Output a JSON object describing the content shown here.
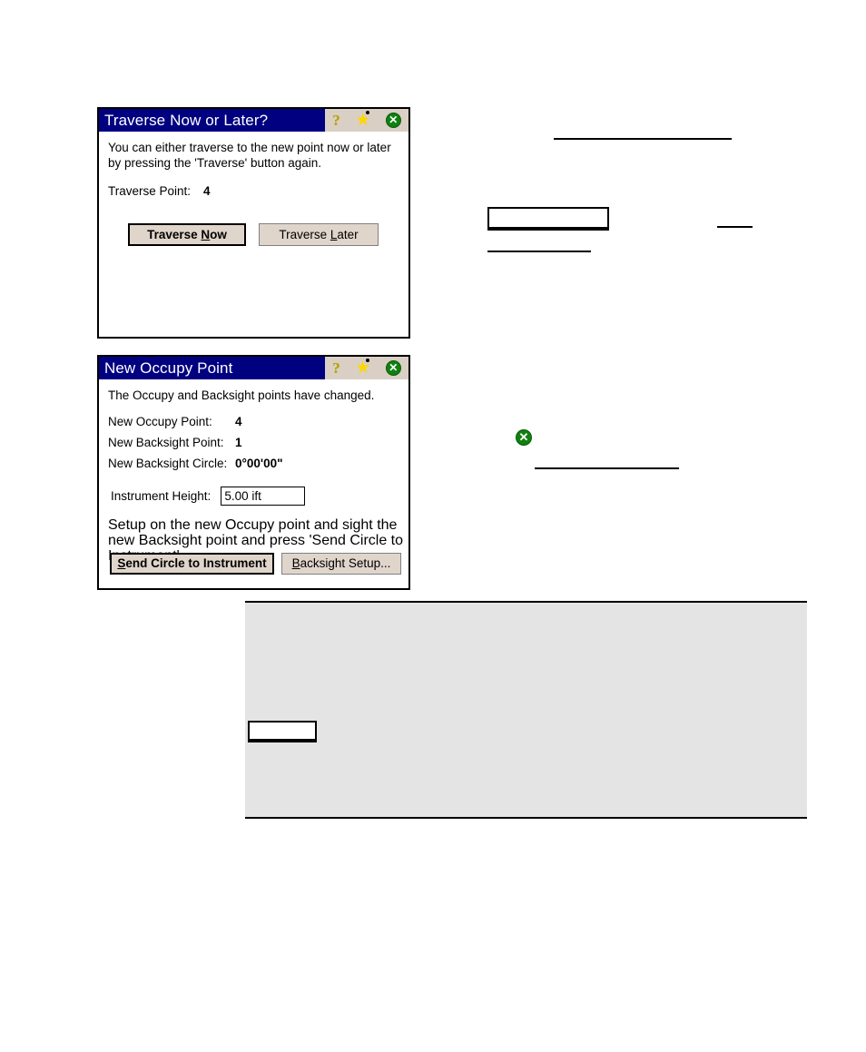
{
  "page": {
    "background_color": "#ffffff",
    "title_bar_color": "#000080",
    "button_face_color": "#e0d5cb",
    "panel_gray_color": "#e4e4e4",
    "close_icon_green": "#108010"
  },
  "dialog_traverse": {
    "title": "Traverse Now or Later?",
    "icons": {
      "help": "?",
      "star": "★",
      "close": "✕"
    },
    "message": "You can either traverse to the new point now or later by pressing the 'Traverse' button again.",
    "point_label": "Traverse Point:",
    "point_value": "4",
    "buttons": {
      "now_prefix": "Traverse ",
      "now_accel": "N",
      "now_suffix": "ow",
      "later_prefix": "Traverse ",
      "later_accel": "L",
      "later_suffix": "ater",
      "now_full": "Traverse Now",
      "later_full": "Traverse Later"
    }
  },
  "dialog_occupy": {
    "title": "New Occupy Point",
    "icons": {
      "help": "?",
      "star": "★",
      "close": "✕"
    },
    "message": "The Occupy and Backsight points have changed.",
    "fields": [
      {
        "label": "New Occupy Point:",
        "value": "4"
      },
      {
        "label": "New Backsight Point:",
        "value": "1"
      },
      {
        "label": "New Backsight Circle:",
        "value": "0°00'00\""
      }
    ],
    "instrument_height": {
      "label": "Instrument Height:",
      "value": "5.00 ift"
    },
    "instructions": "Setup on the new Occupy point and sight the new Backsight point and press 'Send Circle to Instrument'.",
    "buttons": {
      "send_prefix": "",
      "send_accel": "S",
      "send_suffix": "end Circle to Instrument",
      "send_full": "Send Circle to Instrument",
      "backsight_accel": "B",
      "backsight_suffix": "acksight Setup...",
      "backsight_full": "Backsight Setup..."
    }
  }
}
